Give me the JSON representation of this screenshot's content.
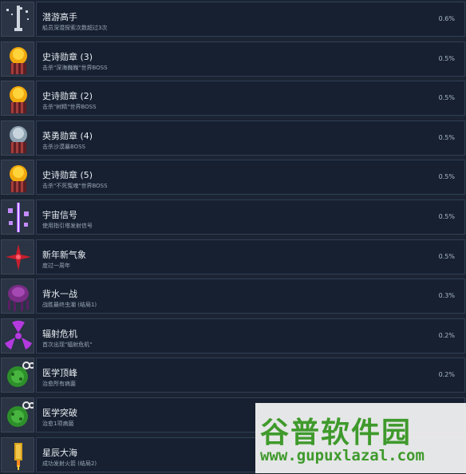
{
  "achievements": [
    {
      "title": "潜游高手",
      "desc": "船员深潜探索次数超过3次",
      "pct": "0.6%",
      "icon": "diving-suit-icon"
    },
    {
      "title": "史诗勋章 (3)",
      "desc": "击杀\"深海巍巍\"世界BOSS",
      "pct": "0.5%",
      "icon": "epic-medal-icon"
    },
    {
      "title": "史诗勋章 (2)",
      "desc": "击杀\"树精\"世界BOSS",
      "pct": "0.5%",
      "icon": "epic-medal-icon"
    },
    {
      "title": "英勇勋章 (4)",
      "desc": "击杀沙漠暴BOSS",
      "pct": "0.5%",
      "icon": "heroic-medal-icon"
    },
    {
      "title": "史诗勋章 (5)",
      "desc": "击杀\"不死冤魂\"世界BOSS",
      "pct": "0.5%",
      "icon": "epic-medal-icon"
    },
    {
      "title": "宇宙信号",
      "desc": "使用指引塔发射信号",
      "pct": "0.5%",
      "icon": "cosmic-signal-icon"
    },
    {
      "title": "新年新气象",
      "desc": "度过一周年",
      "pct": "0.5%",
      "icon": "new-year-star-icon"
    },
    {
      "title": "背水一战",
      "desc": "战胜最终虫潮 (结局1)",
      "pct": "0.3%",
      "icon": "bug-swarm-icon"
    },
    {
      "title": "辐射危机",
      "desc": "首次出现\"辐射危机\"",
      "pct": "0.2%",
      "icon": "radiation-icon"
    },
    {
      "title": "医学顶峰",
      "desc": "治愈所有病菌",
      "pct": "0.2%",
      "icon": "germ-icon"
    },
    {
      "title": "医学突破",
      "desc": "治愈1项病菌",
      "pct": "",
      "icon": "germ-icon"
    },
    {
      "title": "星辰大海",
      "desc": "成功发射火箭 (结局2)",
      "pct": "",
      "icon": "rocket-icon"
    }
  ],
  "watermark": {
    "name": "谷普软件园",
    "url": "www.gupuxlazal.com"
  }
}
